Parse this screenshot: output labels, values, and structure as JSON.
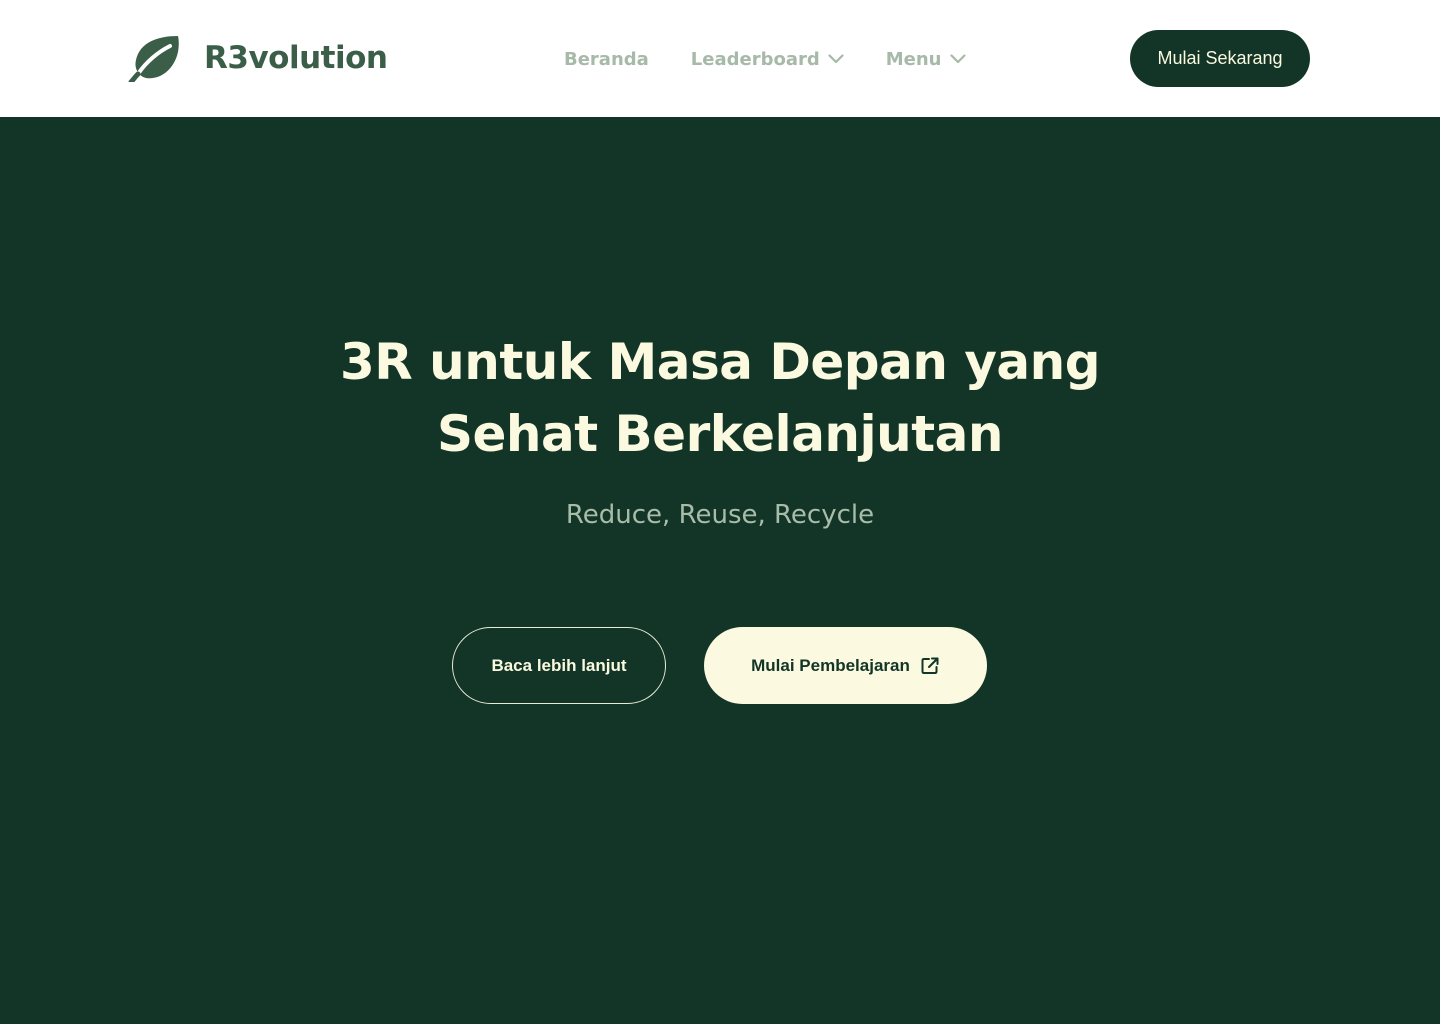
{
  "colors": {
    "header_bg": "#ffffff",
    "hero_bg": "#123527",
    "brand_green": "#3b5e48",
    "nav_text": "#a7b9a8",
    "cream": "#fbf9df",
    "subtitle": "#a9bca9"
  },
  "header": {
    "logo_icon": "leaf-icon",
    "brand_name": "R3volution",
    "nav": [
      {
        "label": "Beranda",
        "has_dropdown": false
      },
      {
        "label": "Leaderboard",
        "has_dropdown": true,
        "icon": "chevron-down-icon"
      },
      {
        "label": "Menu",
        "has_dropdown": true,
        "icon": "chevron-down-icon"
      }
    ],
    "cta_label": "Mulai Sekarang"
  },
  "hero": {
    "title_line1": "3R untuk Masa Depan yang",
    "title_line2": "Sehat Berkelanjutan",
    "subtitle": "Reduce, Reuse, Recycle",
    "secondary_button": "Baca lebih lanjut",
    "primary_button": "Mulai Pembelajaran",
    "primary_button_icon": "external-link-icon"
  }
}
